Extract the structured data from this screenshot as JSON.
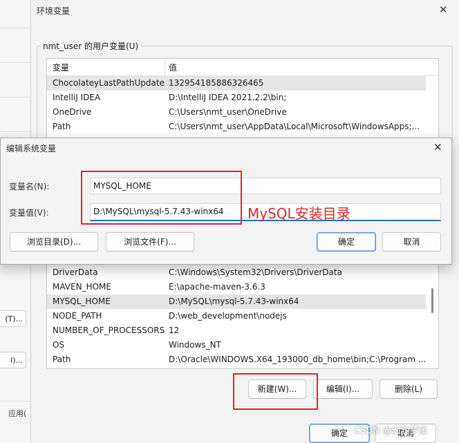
{
  "background_window": {
    "button_1": "(T)...",
    "button_2": "l)...",
    "label_apply": "应用("
  },
  "env_dialog": {
    "title": "环境变量",
    "user_group_label": "nmt_user 的用户变量(U)",
    "columns": [
      "变量",
      "值"
    ],
    "user_vars": [
      {
        "name": "ChocolateyLastPathUpdate",
        "value": "132954185886326465"
      },
      {
        "name": "IntelliJ IDEA",
        "value": "D:\\IntelliJ IDEA 2021.2.2\\bin;"
      },
      {
        "name": "OneDrive",
        "value": "C:\\Users\\nmt_user\\OneDrive"
      },
      {
        "name": "Path",
        "value": "C:\\Users\\nmt_user\\AppData\\Local\\Microsoft\\WindowsApps;..."
      }
    ],
    "system_vars": [
      {
        "name": "DriverData",
        "value": "C:\\Windows\\System32\\Drivers\\DriverData"
      },
      {
        "name": "MAVEN_HOME",
        "value": "E:\\apache-maven-3.6.3"
      },
      {
        "name": "MYSQL_HOME",
        "value": "D:\\MySQL\\mysql-5.7.43-winx64"
      },
      {
        "name": "NODE_PATH",
        "value": "D:\\web_development\\nodejs"
      },
      {
        "name": "NUMBER_OF_PROCESSORS",
        "value": "12"
      },
      {
        "name": "OS",
        "value": "Windows_NT"
      },
      {
        "name": "Path",
        "value": "D:\\Oracle\\WINDOWS.X64_193000_db_home\\bin;C:\\Program ..."
      }
    ],
    "buttons": {
      "new": "新建(W)...",
      "edit": "编辑(I)...",
      "delete": "删除(L)",
      "ok": "确定",
      "cancel": "取消"
    }
  },
  "edit_dialog": {
    "title": "编辑系统变量",
    "name_label": "变量名(N):",
    "value_label": "变量值(V):",
    "name_value": "MYSQL_HOME",
    "value_value": "D:\\MySQL\\mysql-5.7.43-winx64",
    "browse_dir": "浏览目录(D)...",
    "browse_file": "浏览文件(F)...",
    "ok": "确定",
    "cancel": "取消"
  },
  "annotation": "MySQL安装目录",
  "watermark": "CSDN @幻沙梦溪",
  "colors": {
    "annotation_red": "#e0262b",
    "focus_blue": "#1f6fc9",
    "selected_row": "#e5e5e5"
  }
}
